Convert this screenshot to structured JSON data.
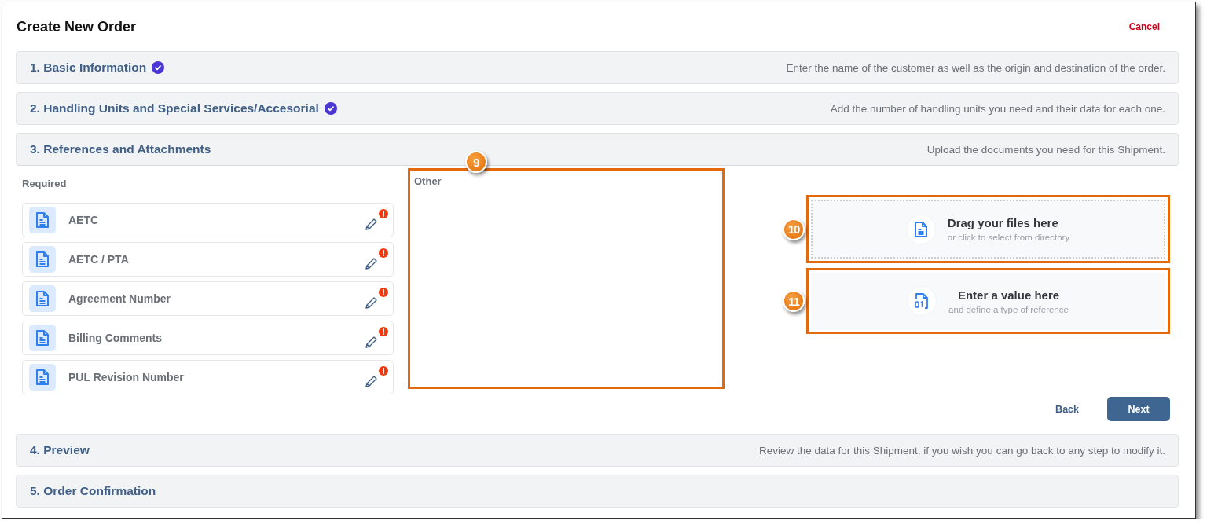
{
  "window": {
    "title": "Create New Order",
    "cancel": "Cancel"
  },
  "steps": [
    {
      "title": "1. Basic Information",
      "completed": true,
      "expanded": false,
      "description": "Enter the name of the customer as well as the origin and destination of the order."
    },
    {
      "title": "2. Handling Units and Special Services/Accesorial",
      "completed": true,
      "expanded": false,
      "description": "Add the number of handling units you need and their data for each one."
    },
    {
      "title": "3. References and Attachments",
      "completed": false,
      "expanded": true,
      "description": "Upload the documents you need for this Shipment."
    },
    {
      "title": "4. Preview",
      "completed": false,
      "expanded": false,
      "description": "Review the data for this Shipment, if you wish you can go back to any step to modify it."
    },
    {
      "title": "5. Order Confirmation",
      "completed": false,
      "expanded": false
    }
  ],
  "references": {
    "required_label": "Required",
    "documents": [
      {
        "name": "AETC",
        "missing": true
      },
      {
        "name": "AETC / PTA",
        "missing": true
      },
      {
        "name": "Agreement Number",
        "missing": true
      },
      {
        "name": "Billing Comments",
        "missing": true
      },
      {
        "name": "PUL Revision Number",
        "missing": true
      }
    ],
    "other": {
      "label": "Other",
      "callout": "9"
    },
    "actions": [
      {
        "kind": "upload",
        "title": "Drag your files here",
        "subtitle": "or click to select from directory",
        "callout": "10"
      },
      {
        "kind": "value",
        "title": "Enter a value here",
        "subtitle": "and define a type of reference",
        "callout": "11"
      }
    ],
    "buttons": [
      {
        "label": "Back",
        "kind": "link"
      },
      {
        "label": "Next",
        "kind": "primary"
      }
    ]
  }
}
